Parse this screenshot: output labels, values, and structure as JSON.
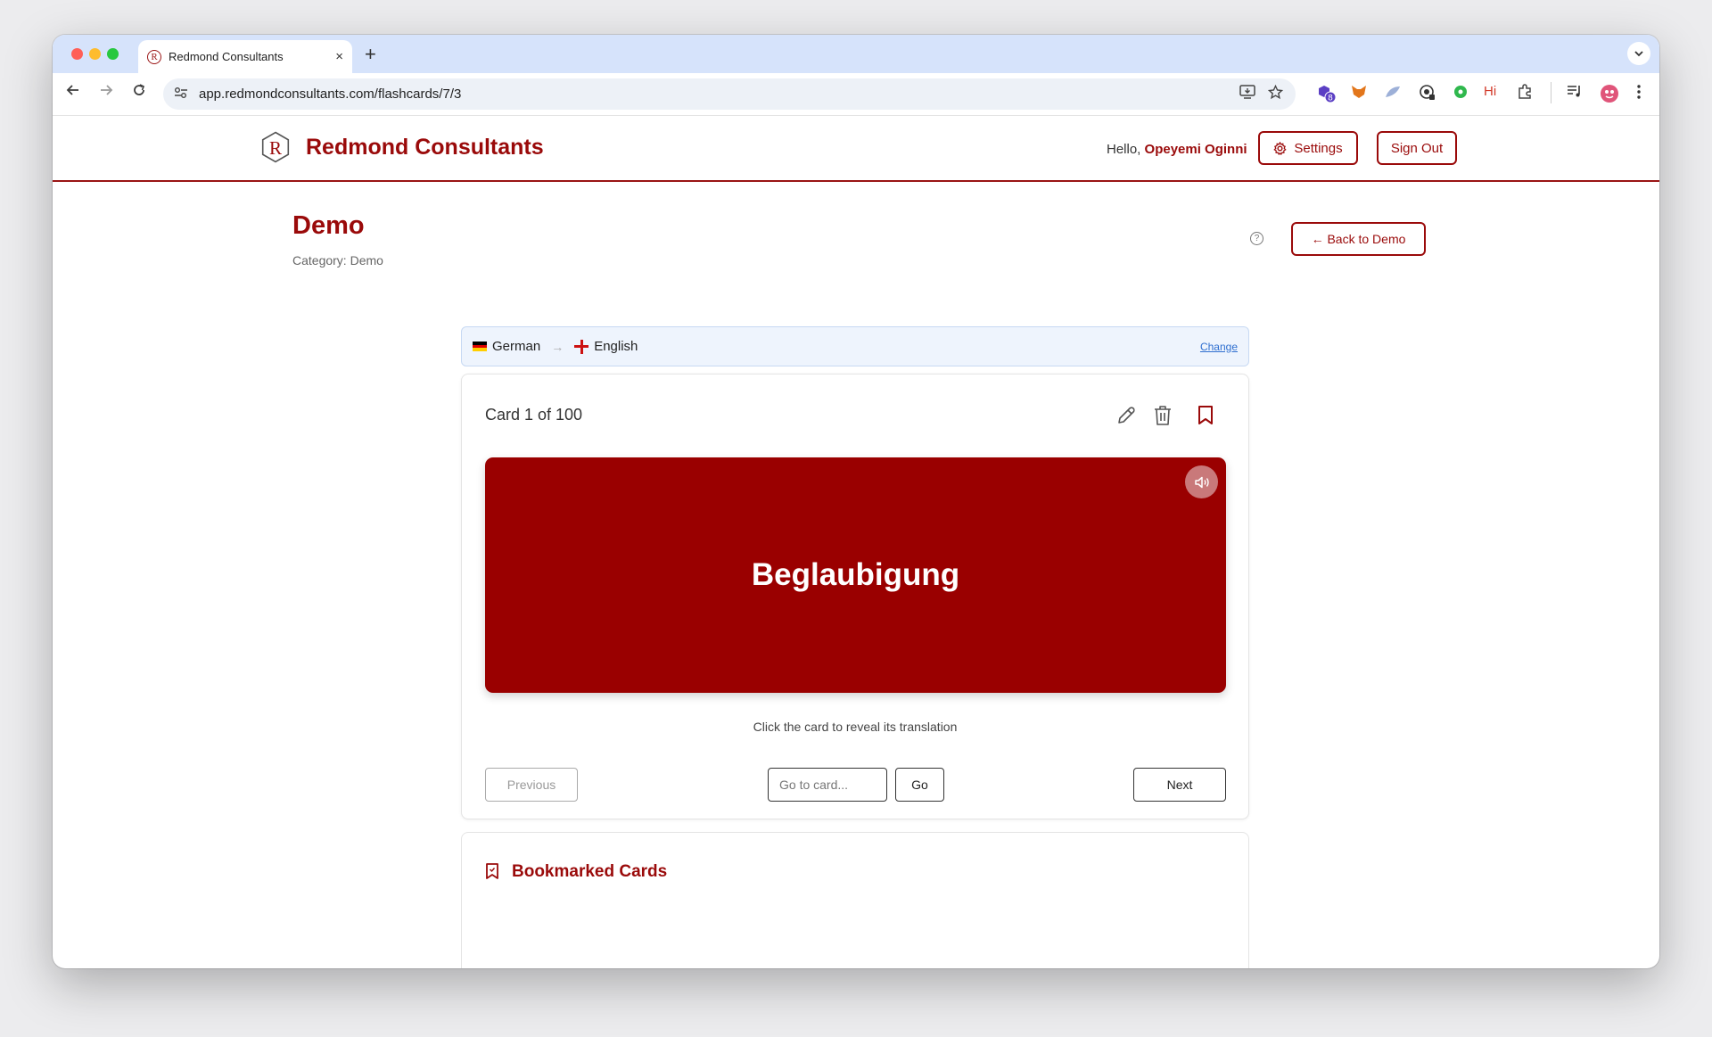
{
  "browser": {
    "tab_title": "Redmond Consultants",
    "tab_close": "×",
    "new_tab": "+",
    "url": "app.redmondconsultants.com/flashcards/7/3",
    "extension_badge": "8",
    "extension_hi": "Hi"
  },
  "header": {
    "logo_letter": "R",
    "brand": "Redmond Consultants",
    "greeting": "Hello,",
    "user_name": "Opeyemi Oginni",
    "settings_label": "Settings",
    "signout_label": "Sign Out"
  },
  "page": {
    "title": "Demo",
    "category": "Category: Demo",
    "help": "?",
    "back_label": "← Back to Demo"
  },
  "languages": {
    "source": "German",
    "arrow": "→",
    "target": "English",
    "change_label": "Change"
  },
  "card": {
    "counter": "Card 1 of 100",
    "word": "Beglaubigung",
    "hint": "Click the card to reveal its translation",
    "previous_label": "Previous",
    "goto_placeholder": "Go to card...",
    "go_label": "Go",
    "next_label": "Next"
  },
  "bookmarks": {
    "title": "Bookmarked Cards"
  },
  "colors": {
    "brand": "#9a0a0a",
    "card_bg": "#9a0000"
  }
}
